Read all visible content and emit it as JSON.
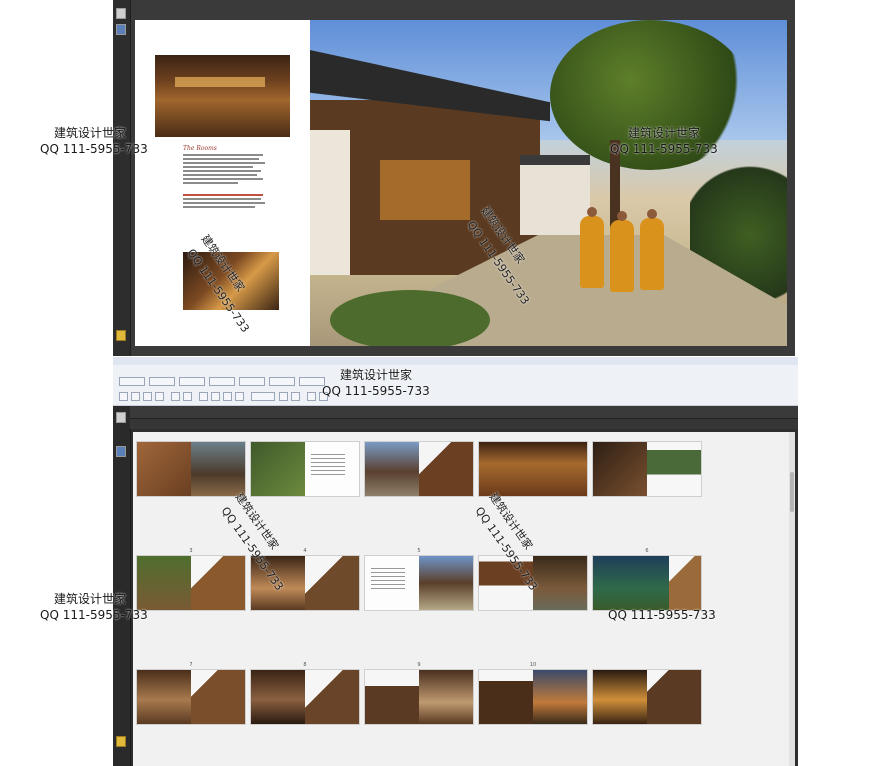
{
  "top_viewer": {
    "left_page": {
      "heading": "The Rooms"
    }
  },
  "app": {
    "title": "",
    "menu_items": [],
    "toolbar_buttons": []
  },
  "thumbnails": {
    "panel_tab": "",
    "page_numbers": [
      "3",
      "4",
      "5",
      "6",
      "7",
      "8",
      "9",
      "10"
    ],
    "rows": [
      [
        "lobby-spread",
        "garden-spread",
        "courtyard-spread",
        "restaurant-spread",
        "dining-spread"
      ],
      [
        "bamboo-spread",
        "hall-spread",
        "courtyard2-spread",
        "suite-spread",
        "pavilion-spread"
      ],
      [
        "bedroom-spread",
        "bedroom2-spread",
        "tub-spread",
        "dusk-spread",
        "night-spread"
      ]
    ]
  },
  "watermarks": {
    "brand": "建筑设计世家",
    "qq": "QQ 111-5955-733"
  },
  "colors": {
    "viewer_bg": "#3a3a3a",
    "chrome_bg": "#eef1f6",
    "thumb_area_bg": "#f1f1f1",
    "robe": "#d9921c"
  }
}
